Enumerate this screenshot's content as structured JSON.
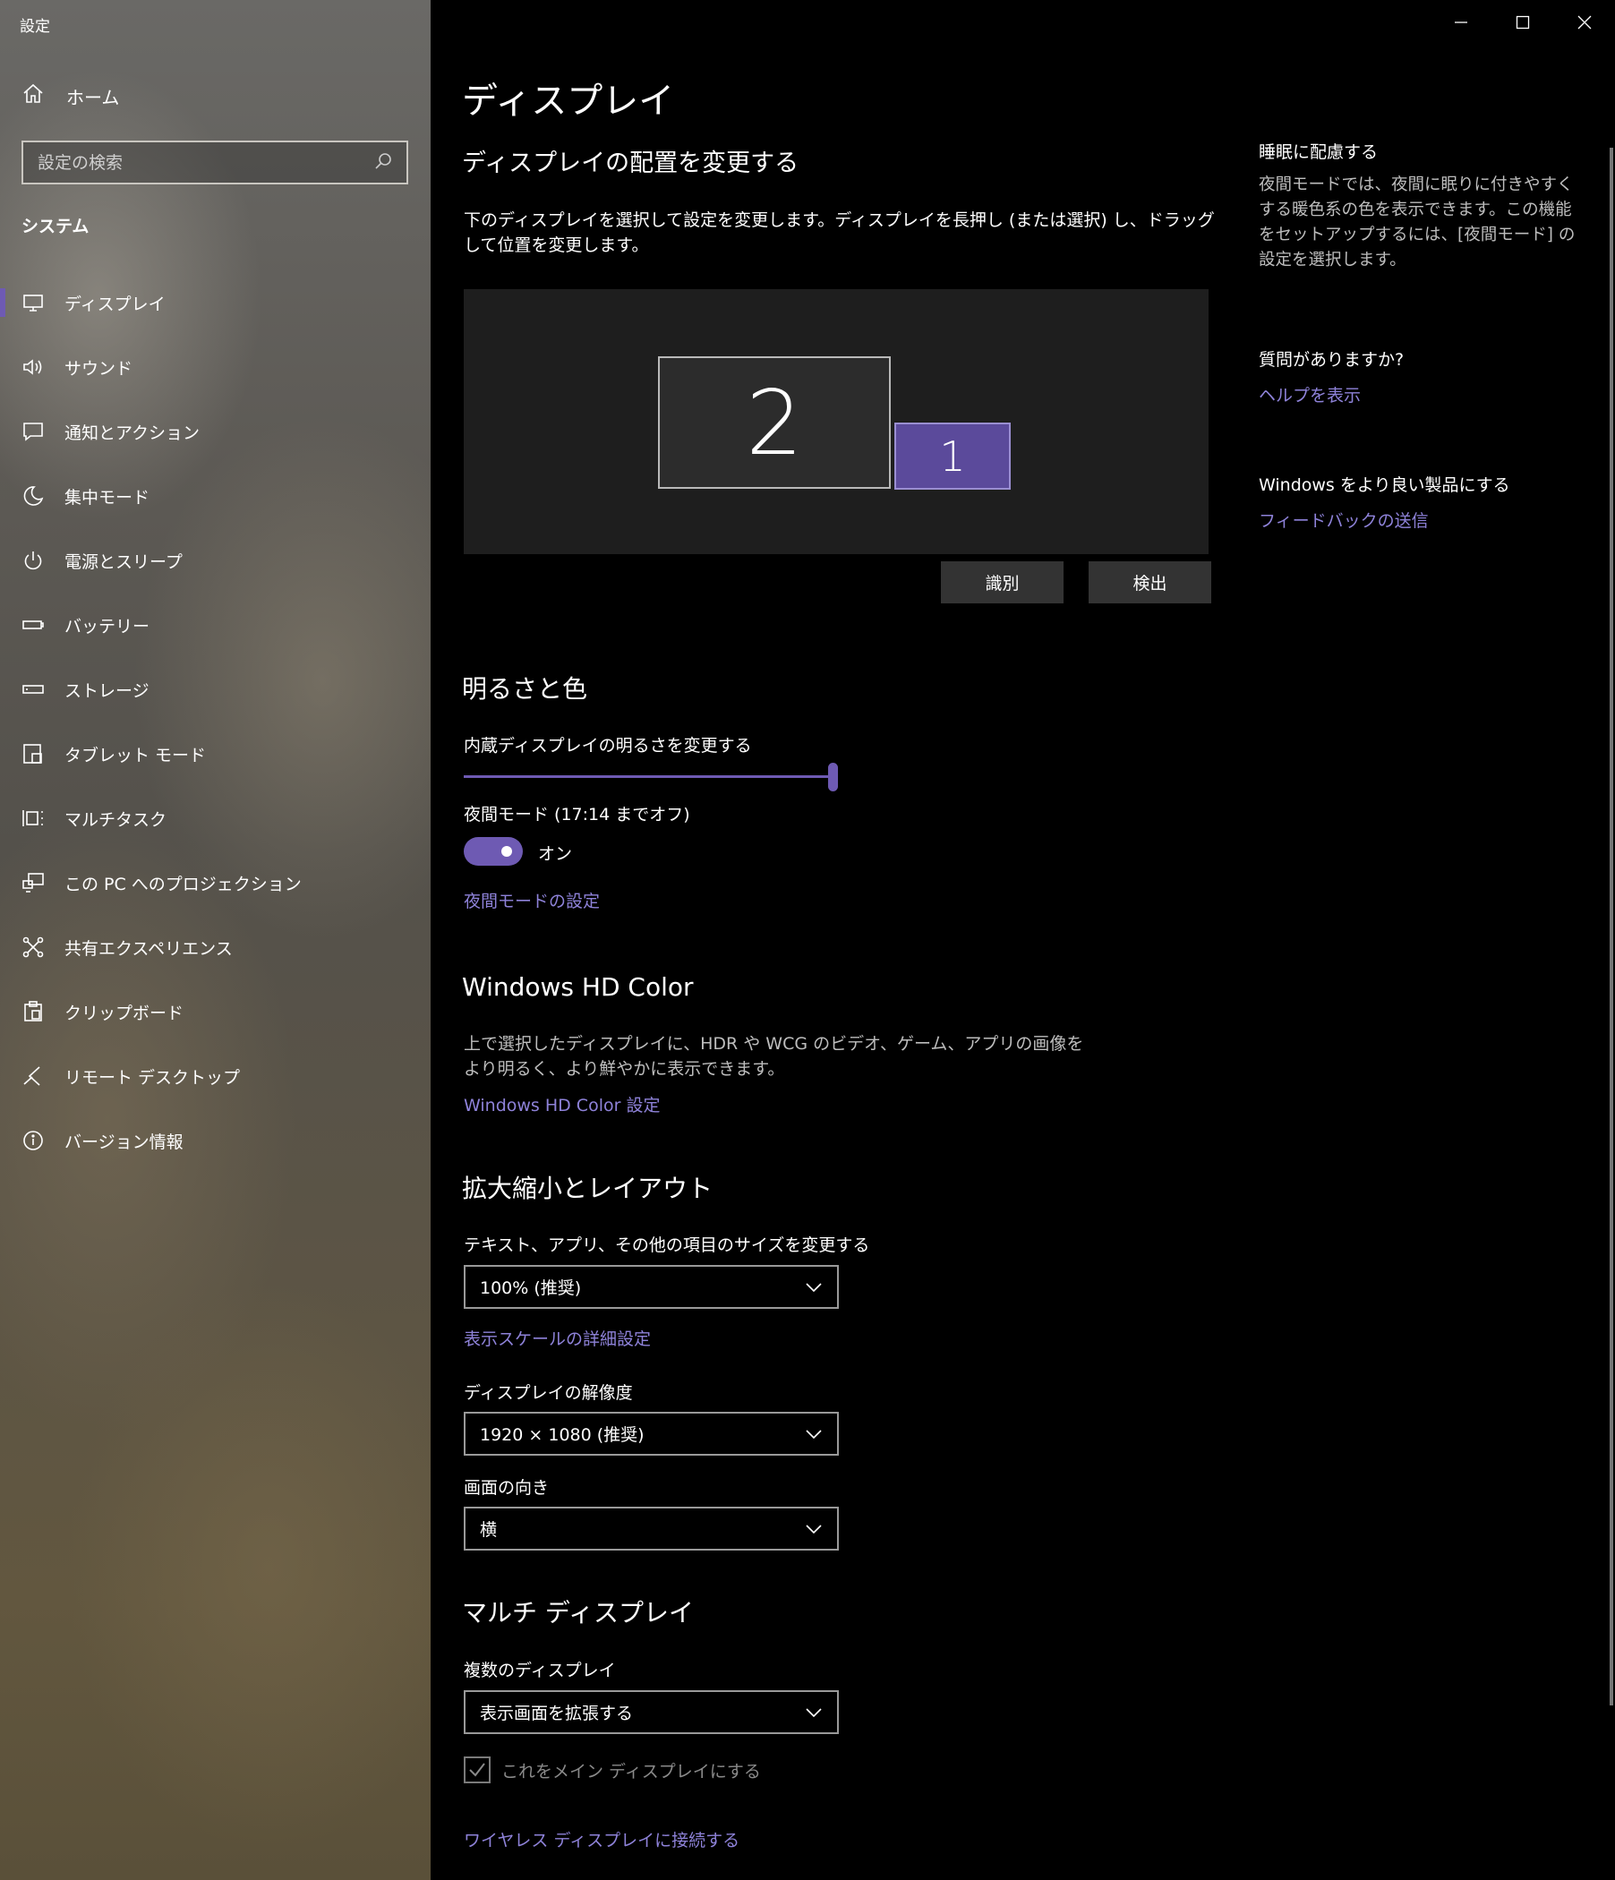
{
  "window": {
    "title": "設定"
  },
  "sidebar": {
    "home_label": "ホーム",
    "search_placeholder": "設定の検索",
    "section_title": "システム",
    "items": [
      {
        "label": "ディスプレイ",
        "icon": "monitor-icon",
        "active": true
      },
      {
        "label": "サウンド",
        "icon": "speaker-icon"
      },
      {
        "label": "通知とアクション",
        "icon": "notification-icon"
      },
      {
        "label": "集中モード",
        "icon": "moon-icon"
      },
      {
        "label": "電源とスリープ",
        "icon": "power-icon"
      },
      {
        "label": "バッテリー",
        "icon": "battery-icon"
      },
      {
        "label": "ストレージ",
        "icon": "storage-icon"
      },
      {
        "label": "タブレット モード",
        "icon": "tablet-icon"
      },
      {
        "label": "マルチタスク",
        "icon": "multitask-icon"
      },
      {
        "label": "この PC へのプロジェクション",
        "icon": "projection-icon"
      },
      {
        "label": "共有エクスペリエンス",
        "icon": "shared-icon"
      },
      {
        "label": "クリップボード",
        "icon": "clipboard-icon"
      },
      {
        "label": "リモート デスクトップ",
        "icon": "remote-icon"
      },
      {
        "label": "バージョン情報",
        "icon": "info-icon"
      }
    ]
  },
  "main": {
    "page_title": "ディスプレイ",
    "arrange": {
      "heading": "ディスプレイの配置を変更する",
      "description": "下のディスプレイを選択して設定を変更します。ディスプレイを長押し (または選択) し、ドラッグして位置を変更します。",
      "monitor_2": "2",
      "monitor_1": "1",
      "identify_button": "識別",
      "detect_button": "検出"
    },
    "brightness": {
      "heading": "明るさと色",
      "label": "内蔵ディスプレイの明るさを変更する",
      "value_percent": 100,
      "night_mode_label": "夜間モード (17:14 までオフ)",
      "night_mode_state": "オン",
      "night_mode_on": true,
      "night_mode_link": "夜間モードの設定"
    },
    "hdr": {
      "heading": "Windows HD Color",
      "description": "上で選択したディスプレイに、HDR や WCG のビデオ、ゲーム、アプリの画像をより明るく、より鮮やかに表示できます。",
      "link": "Windows HD Color 設定"
    },
    "scale": {
      "heading": "拡大縮小とレイアウト",
      "size_label": "テキスト、アプリ、その他の項目のサイズを変更する",
      "size_value": "100% (推奨)",
      "advanced_link": "表示スケールの詳細設定",
      "resolution_label": "ディスプレイの解像度",
      "resolution_value": "1920 × 1080 (推奨)",
      "orientation_label": "画面の向き",
      "orientation_value": "横"
    },
    "multi": {
      "heading": "マルチ ディスプレイ",
      "label": "複数のディスプレイ",
      "value": "表示画面を拡張する",
      "main_display_checkbox": "これをメイン ディスプレイにする",
      "main_display_checked": true,
      "wireless_link": "ワイヤレス ディスプレイに接続する"
    }
  },
  "side_panel": {
    "sleep_heading": "睡眠に配慮する",
    "sleep_description": "夜間モードでは、夜間に眠りに付きやすくする暖色系の色を表示できます。この機能をセットアップするには、[夜間モード] の設定を選択します。",
    "question_heading": "質問がありますか?",
    "help_link": "ヘルプを表示",
    "better_heading": "Windows をより良い製品にする",
    "feedback_link": "フィードバックの送信"
  },
  "colors": {
    "accent": "#6e5ab3",
    "link": "#8e82d9"
  }
}
